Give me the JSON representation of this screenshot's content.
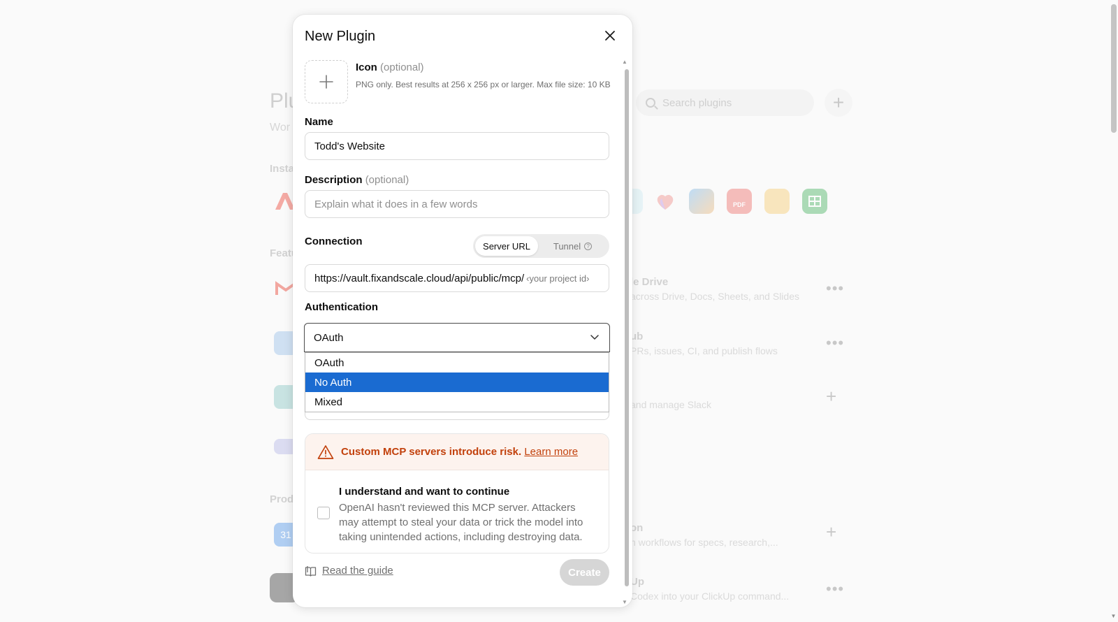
{
  "background": {
    "page_title": "Plu",
    "page_subtitle": "Wor",
    "section_installed": "Insta",
    "section_featured": "Featu",
    "section_productivity": "Prod",
    "search_placeholder": "Search plugins",
    "rows": [
      {
        "title": "le Drive",
        "desc": "across Drive, Docs, Sheets, and Slides",
        "action": "more"
      },
      {
        "title": "ub",
        "desc": "PRs, issues, CI, and publish flows",
        "action": "more"
      },
      {
        "title": "",
        "desc": "and manage Slack",
        "action": "add"
      },
      {
        "title": "on",
        "desc": "n workflows for specs, research,...",
        "action": "add"
      },
      {
        "title": "Up",
        "desc": "Codex into your ClickUp command...",
        "action": "more"
      }
    ],
    "calendar_badge": "31"
  },
  "modal": {
    "title": "New Plugin",
    "icon": {
      "label": "Icon",
      "optional": "(optional)",
      "help": "PNG only. Best results at 256 x 256 px or larger. Max file size: 10 KB"
    },
    "name": {
      "label": "Name",
      "value": "Todd's Website"
    },
    "description": {
      "label": "Description",
      "optional": "(optional)",
      "placeholder": "Explain what it does in a few words"
    },
    "connection": {
      "label": "Connection",
      "options": [
        "Server URL",
        "Tunnel"
      ],
      "selected": "Server URL",
      "url_prefix": "https://vault.fixandscale.cloud/api/public/mcp/",
      "url_suffix": "‹your project id›"
    },
    "authentication": {
      "label": "Authentication",
      "value": "OAuth",
      "options": [
        "OAuth",
        "No Auth",
        "Mixed"
      ],
      "highlighted": "No Auth"
    },
    "risk": {
      "warning": "Custom MCP servers introduce risk.",
      "learn_more": "Learn more",
      "ack_title": "I understand and want to continue",
      "ack_desc": "OpenAI hasn't reviewed this MCP server. Attackers may attempt to steal your data or trick the model into taking unintended actions, including destroying data.",
      "checked": false
    },
    "footer": {
      "guide": "Read the guide",
      "create": "Create"
    }
  },
  "colors": {
    "warning_text": "#c2410c",
    "warning_bg": "#fdf3ee",
    "highlight": "#1a6bd1",
    "create_disabled": "#d6d6d6"
  }
}
